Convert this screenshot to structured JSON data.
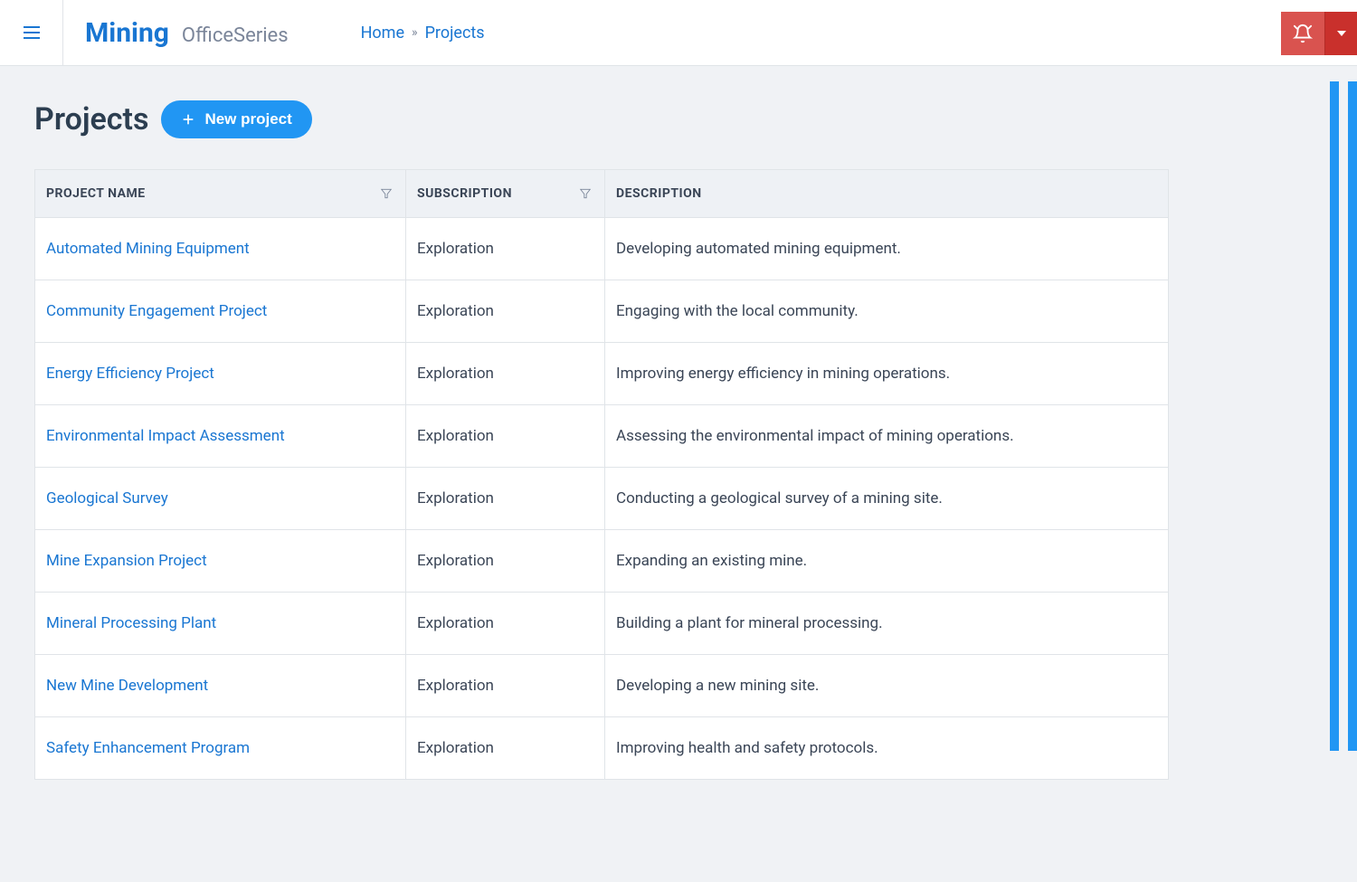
{
  "header": {
    "brand_name": "Mining",
    "brand_suffix": "OfficeSeries",
    "breadcrumb": {
      "home": "Home",
      "current": "Projects"
    }
  },
  "page": {
    "title": "Projects",
    "new_button_label": "New project"
  },
  "table": {
    "columns": {
      "name": "PROJECT NAME",
      "subscription": "SUBSCRIPTION",
      "description": "DESCRIPTION"
    },
    "rows": [
      {
        "name": "Automated Mining Equipment",
        "subscription": "Exploration",
        "description": "Developing automated mining equipment."
      },
      {
        "name": "Community Engagement Project",
        "subscription": "Exploration",
        "description": "Engaging with the local community."
      },
      {
        "name": "Energy Efficiency Project",
        "subscription": "Exploration",
        "description": "Improving energy efficiency in mining operations."
      },
      {
        "name": "Environmental Impact Assessment",
        "subscription": "Exploration",
        "description": "Assessing the environmental impact of mining operations."
      },
      {
        "name": "Geological Survey",
        "subscription": "Exploration",
        "description": "Conducting a geological survey of a mining site."
      },
      {
        "name": "Mine Expansion Project",
        "subscription": "Exploration",
        "description": "Expanding an existing mine."
      },
      {
        "name": "Mineral Processing Plant",
        "subscription": "Exploration",
        "description": "Building a plant for mineral processing."
      },
      {
        "name": "New Mine Development",
        "subscription": "Exploration",
        "description": "Developing a new mining site."
      },
      {
        "name": "Safety Enhancement Program",
        "subscription": "Exploration",
        "description": "Improving health and safety protocols."
      }
    ]
  }
}
